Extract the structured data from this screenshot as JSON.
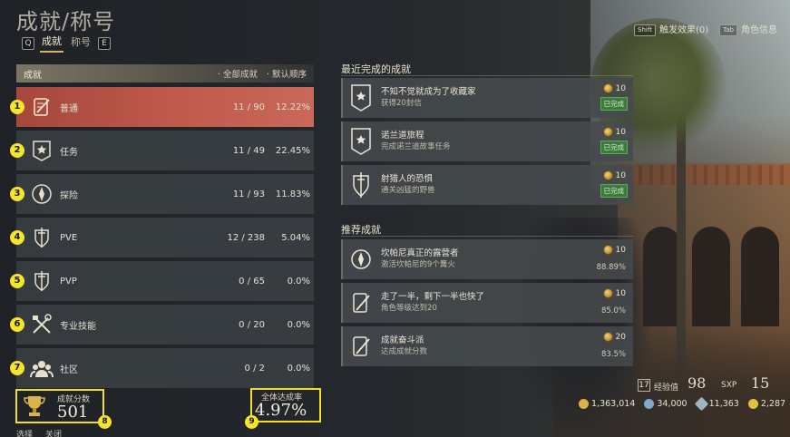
{
  "title": "成就/称号",
  "tabs": {
    "left_key": "Q",
    "items": [
      "成就",
      "称号"
    ],
    "active": 0,
    "right_key": "E"
  },
  "top_right": [
    {
      "key": "Shift",
      "label": "触发效果(0)"
    },
    {
      "key": "Tab",
      "label": "角色信息"
    }
  ],
  "list_header": {
    "label": "成就",
    "sort_all": "· 全部成就",
    "sort_default": "· 默认顺序"
  },
  "categories": [
    {
      "num": "1",
      "name": "普通",
      "count": "11 / 90",
      "pct": "12.22%",
      "icon": "quill-scroll-icon"
    },
    {
      "num": "2",
      "name": "任务",
      "count": "11 / 49",
      "pct": "22.45%",
      "icon": "quest-badge-icon"
    },
    {
      "num": "3",
      "name": "探险",
      "count": "11 / 93",
      "pct": "11.83%",
      "icon": "compass-icon"
    },
    {
      "num": "4",
      "name": "PVE",
      "count": "12 / 238",
      "pct": "5.04%",
      "icon": "sword-shield-icon"
    },
    {
      "num": "5",
      "name": "PVP",
      "count": "0 / 65",
      "pct": "0.0%",
      "icon": "sword-shield-icon"
    },
    {
      "num": "6",
      "name": "专业技能",
      "count": "0 / 20",
      "pct": "0.0%",
      "icon": "crossed-tools-icon"
    },
    {
      "num": "7",
      "name": "社区",
      "count": "0 / 2",
      "pct": "0.0%",
      "icon": "community-icon"
    }
  ],
  "score": {
    "label": "成就分数",
    "value": "501",
    "num": "8"
  },
  "rate": {
    "label": "全体达成率",
    "value": "4.97%",
    "num": "9"
  },
  "bottom_hints": [
    "选择",
    "关闭"
  ],
  "recent": {
    "title": "最近完成的成就",
    "items": [
      {
        "name": "不知不觉就成为了收藏家",
        "desc": "获得20封信",
        "points": "10",
        "status": "已完成",
        "icon": "quest-badge-icon"
      },
      {
        "name": "诺兰道旅程",
        "desc": "完成诺兰道故事任务",
        "points": "10",
        "status": "已完成",
        "icon": "quest-badge-icon"
      },
      {
        "name": "射猎人的恐惧",
        "desc": "通关凶猛的野兽",
        "points": "10",
        "status": "已完成",
        "icon": "sword-shield-icon"
      }
    ]
  },
  "recommended": {
    "title": "推荐成就",
    "items": [
      {
        "name": "坎帕尼真正的露营者",
        "desc": "激活坎帕尼的9个篝火",
        "points": "10",
        "pct": "88.89%",
        "icon": "compass-icon"
      },
      {
        "name": "走了一半，剩下一半也快了",
        "desc": "角色等级达到20",
        "points": "10",
        "pct": "85.0%",
        "icon": "quill-scroll-icon"
      },
      {
        "name": "成就奋斗派",
        "desc": "达成成就分数",
        "points": "20",
        "pct": "83.5%",
        "icon": "quill-scroll-icon"
      }
    ]
  },
  "player": {
    "level": "17",
    "exp_label": "经验值",
    "exp_value": "98",
    "sxp_label": "SXP",
    "sxp_value": "15",
    "currencies": [
      {
        "value": "1,363,014",
        "color": "#d9b24a",
        "icon": "gold-coin-icon"
      },
      {
        "value": "34,000",
        "color": "#7fa9c9",
        "icon": "silver-coin-icon"
      },
      {
        "value": "11,363",
        "color": "#9fb5c4",
        "icon": "crystal-icon"
      },
      {
        "value": "2,287",
        "color": "#e0c23c",
        "icon": "token-icon"
      }
    ]
  }
}
